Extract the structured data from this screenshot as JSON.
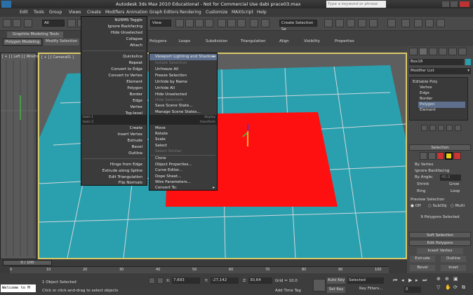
{
  "title": "Autodesk 3ds Max  2010  Educational - Not for Commercial Use   dabi prace03.max",
  "search_placeholder": "Type a keyword or phrase",
  "menubar": [
    "Edit",
    "Tools",
    "Group",
    "Views",
    "Create",
    "Modifiers",
    "Animation",
    "Graph Editors",
    "Rendering",
    "Customize",
    "MAXScript",
    "Help"
  ],
  "toolbar": {
    "selection_filter": "All",
    "view_dropdown": "View",
    "selection_set": "Create Selection Se"
  },
  "ribbon": {
    "graphite_tab": "Graphite Modeling Tools",
    "tabs": [
      "Polygon Modeling",
      "Modify Selection",
      "Polygons",
      "Loops",
      "Subdivision",
      "Triangulation",
      "Align",
      "Visibility",
      "Properties"
    ]
  },
  "viewports": {
    "left_label": "[ + ] [ Left ] [ Wireframe ]",
    "main_label": "[ + ] [ Camera01 ]"
  },
  "quad_left": {
    "items": [
      "NURMS Toggle",
      "Ignore Backfacing",
      "Hide Unselected",
      "Collapse",
      "Attach",
      "Quickslice",
      "Repeat",
      "Convert to Edge",
      "Convert to Vertex",
      "Element",
      "Polygon",
      "Border",
      "Edge",
      "Vertex",
      "Top-level",
      "tools 1",
      "tools 2",
      "Create",
      "Insert Vertex",
      "Extrude",
      "Bevel",
      "Outline",
      "Hinge from Edge",
      "Extrude along Spline",
      "Edit Triangulation",
      "Flip Normals"
    ]
  },
  "quad_right": {
    "items": [
      "Viewport Lighting and Shadows",
      "Isolate Selection",
      "Unfreeze All",
      "Freeze Selection",
      "Unhide by Name",
      "Unhide All",
      "Hide Unselected",
      "Hide Selection",
      "Save Scene State...",
      "Manage Scene States...",
      "display",
      "transform",
      "Move",
      "Rotate",
      "Scale",
      "Select",
      "Select Similar",
      "Clone",
      "Object Properties...",
      "Curve Editor...",
      "Dope Sheet...",
      "Wire Parameters...",
      "Convert To:"
    ]
  },
  "cmdpanel": {
    "object_name": "Box18",
    "modifier_list": "Modifier List",
    "stack": [
      "Editable Poly",
      "Vertex",
      "Edge",
      "Border",
      "Polygon",
      "Element"
    ],
    "selection_title": "Selection",
    "by_vertex": "By Vertex",
    "ignore_backfacing": "Ignore Backfacing",
    "by_angle": "By Angle:",
    "angle_value": "45.0",
    "shrink": "Shrink",
    "grow": "Grow",
    "ring": "Ring",
    "loop": "Loop",
    "preview_selection": "Preview Selection",
    "preview_off": "Off",
    "preview_subobj": "SubObj",
    "preview_multi": "Multi",
    "selected_info": "9 Polygons Selected",
    "soft_selection": "Soft Selection",
    "edit_polygons": "Edit Polygons",
    "insert_vertex": "Insert Vertex",
    "extrude": "Extrude",
    "outline": "Outline",
    "bevel": "Bevel",
    "inset": "Inset"
  },
  "timeline": {
    "frame": "0 / 100",
    "ticks": [
      "0",
      "10",
      "20",
      "30",
      "40",
      "50",
      "60",
      "70",
      "80",
      "90",
      "100"
    ]
  },
  "status": {
    "maxscript": "Welcome to M",
    "objects_selected": "1 Object Selected",
    "prompt": "Click or click-and-drag to select objects",
    "x_label": "X:",
    "x": "7,693",
    "y_label": "Y:",
    "y": "-27,142",
    "z_label": "Z:",
    "z": "30,64",
    "grid": "Grid = 10,0",
    "auto_key": "Auto Key",
    "selected_dropdown": "Selected",
    "set_key": "Set Key",
    "key_filters": "Key Filters...",
    "add_time_tag": "Add Time Tag",
    "frame_field": "0"
  },
  "colors": {
    "floor": "#2a9fae",
    "selection": "#ff1010",
    "active_border": "#d8c96c",
    "menu_hl": "#5d6f8c"
  }
}
